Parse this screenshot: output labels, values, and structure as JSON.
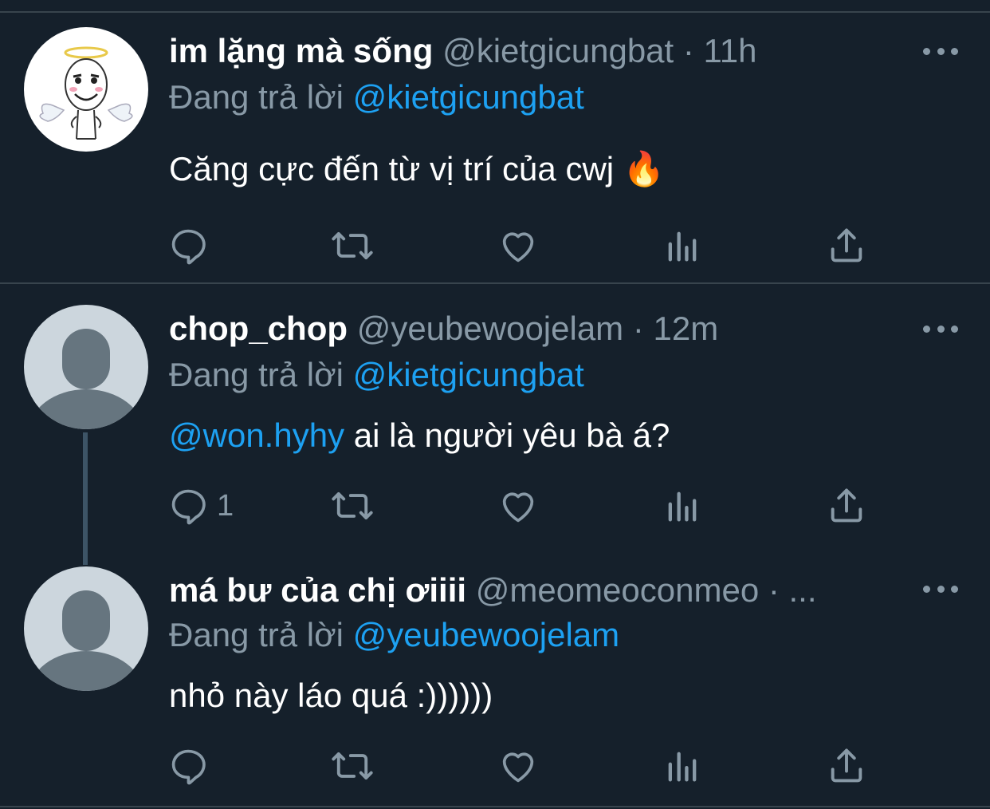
{
  "theme": {
    "background": "#15202b",
    "divider": "#38444d",
    "text": "#ffffff",
    "muted": "#8899a6",
    "accent": "#1da1f2",
    "icon": "#8899a6"
  },
  "tweets": [
    {
      "display_name": "im lặng mà sống",
      "handle": "@kietgicungbat",
      "separator": " · ",
      "time": "11h",
      "reply_prefix": "Đang trả lời ",
      "reply_to": "@kietgicungbat",
      "body_mention": "",
      "body_text": "Căng cực đến từ vị trí của cwj 🔥",
      "avatar": "angel-meme-avatar",
      "actions": {
        "reply_count": "",
        "retweet_count": "",
        "like_count": ""
      }
    },
    {
      "display_name": "chop_chop",
      "handle": "@yeubewoojelam",
      "separator": " · ",
      "time": "12m",
      "reply_prefix": "Đang trả lời ",
      "reply_to": "@kietgicungbat",
      "body_mention": "@won.hyhy",
      "body_text": " ai là người yêu bà á?",
      "avatar": "default-avatar",
      "actions": {
        "reply_count": "1",
        "retweet_count": "",
        "like_count": ""
      }
    },
    {
      "display_name": "má bư của chị ơiiii",
      "handle": "@meomeoconmeo",
      "separator": " · ",
      "time": "...",
      "reply_prefix": "Đang trả lời ",
      "reply_to": "@yeubewoojelam",
      "body_mention": "",
      "body_text": "nhỏ này láo quá :))))))",
      "avatar": "default-avatar",
      "actions": {
        "reply_count": "",
        "retweet_count": "",
        "like_count": ""
      }
    }
  ],
  "icons": {
    "reply": "reply-icon",
    "retweet": "retweet-icon",
    "like": "heart-icon",
    "analytics": "analytics-icon",
    "share": "share-icon",
    "more": "more-icon"
  }
}
